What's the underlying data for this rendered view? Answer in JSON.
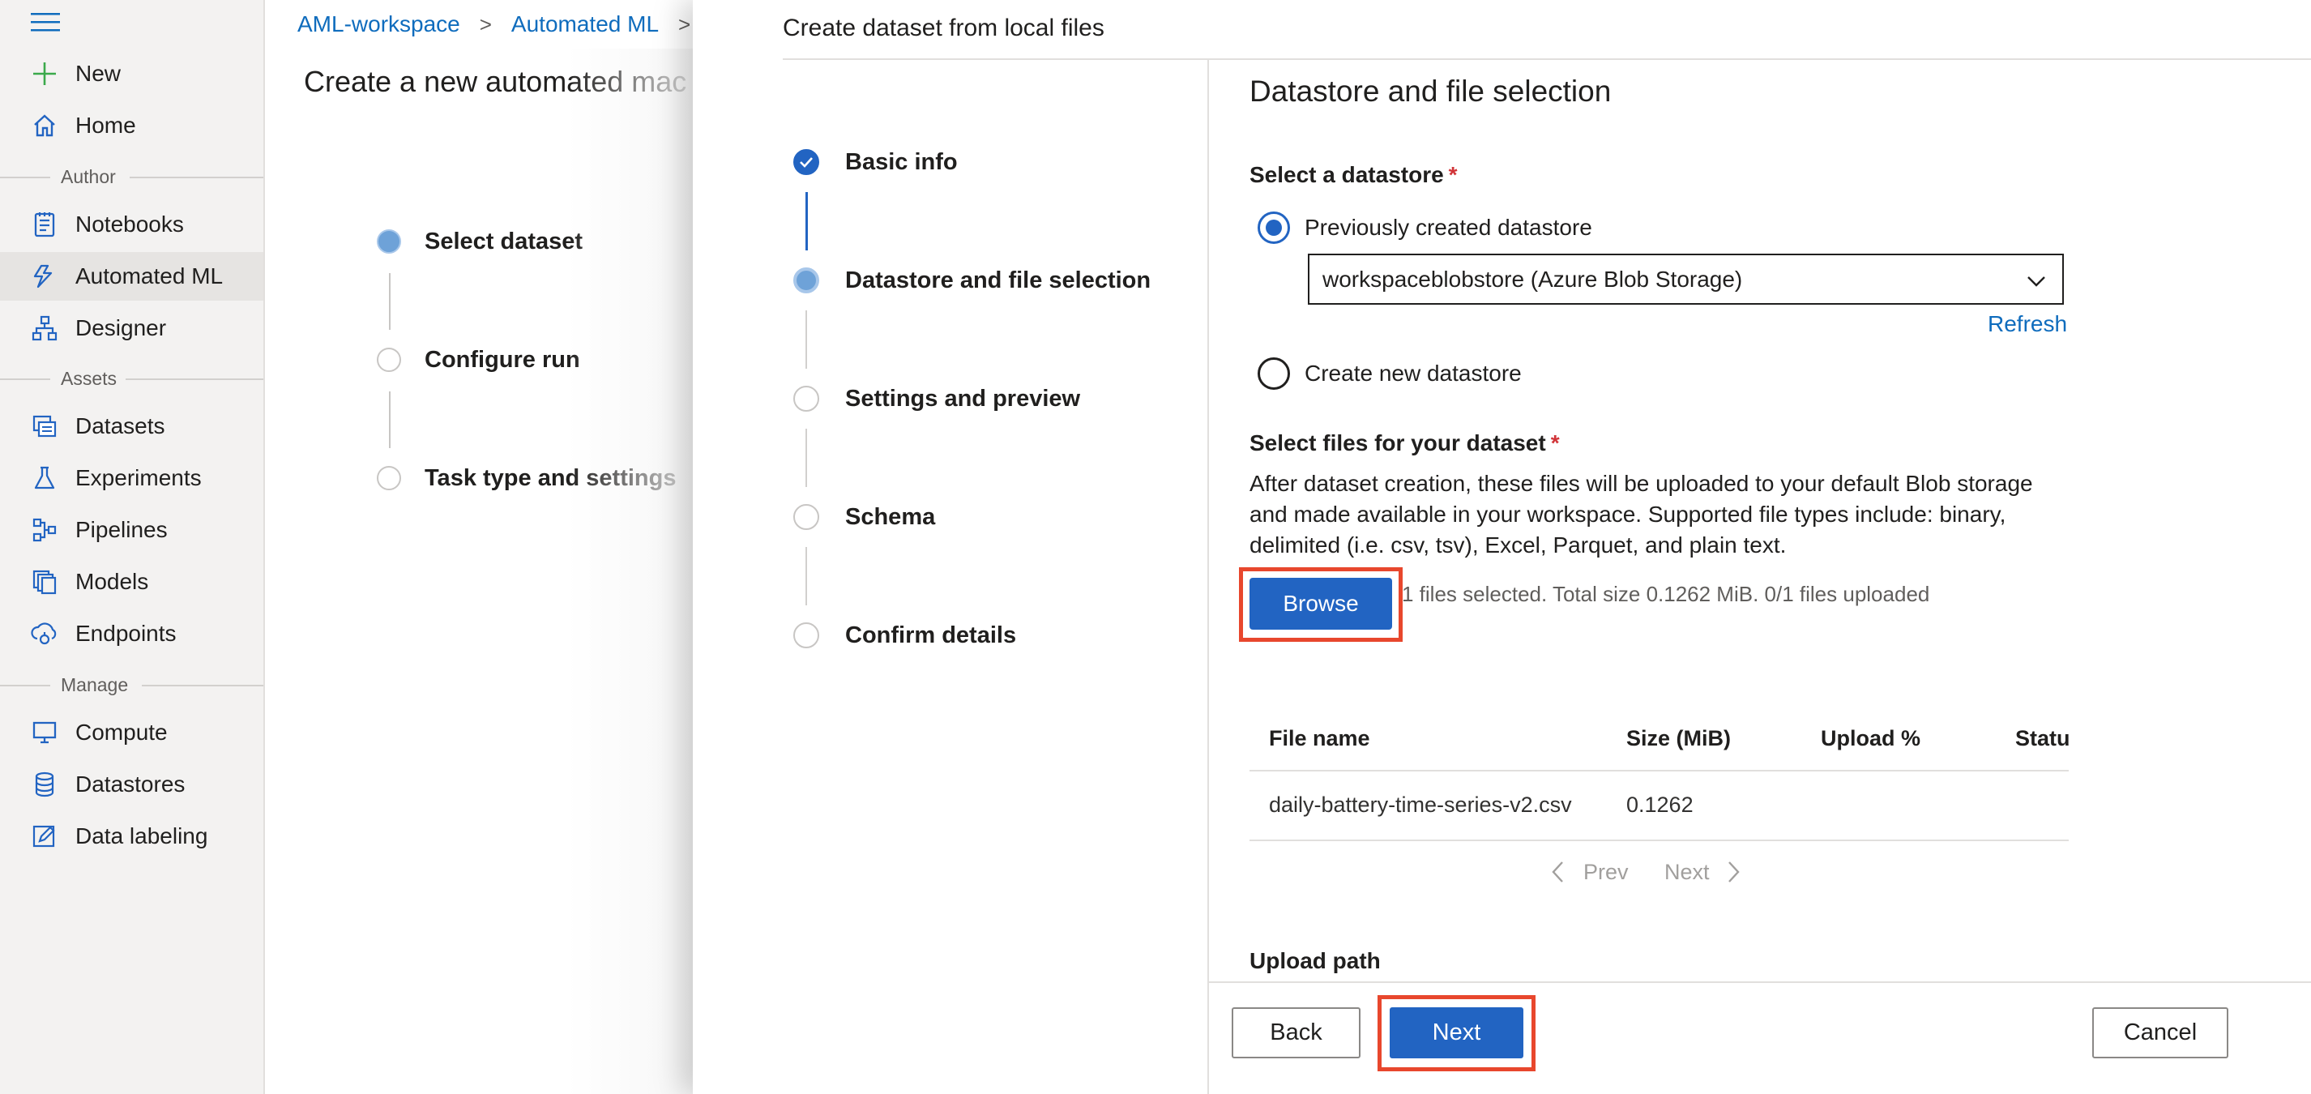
{
  "sidenav": {
    "items": [
      {
        "label": "New",
        "icon": "plus-icon"
      },
      {
        "label": "Home",
        "icon": "home-icon"
      },
      {
        "label": "Notebooks",
        "icon": "notebook-icon"
      },
      {
        "label": "Automated ML",
        "icon": "automated-ml-icon",
        "active": true
      },
      {
        "label": "Designer",
        "icon": "designer-icon"
      },
      {
        "label": "Datasets",
        "icon": "datasets-icon"
      },
      {
        "label": "Experiments",
        "icon": "flask-icon"
      },
      {
        "label": "Pipelines",
        "icon": "pipelines-icon"
      },
      {
        "label": "Models",
        "icon": "models-icon"
      },
      {
        "label": "Endpoints",
        "icon": "endpoints-icon"
      },
      {
        "label": "Compute",
        "icon": "monitor-icon"
      },
      {
        "label": "Datastores",
        "icon": "database-icon"
      },
      {
        "label": "Data labeling",
        "icon": "edit-icon"
      }
    ],
    "sections": {
      "author": "Author",
      "assets": "Assets",
      "manage": "Manage"
    }
  },
  "breadcrumb": {
    "workspace": "AML-workspace",
    "section": "Automated ML"
  },
  "background_page": {
    "title": "Create a new automated mac",
    "steps": [
      "Select dataset",
      "Configure run",
      "Task type and settings"
    ]
  },
  "panel": {
    "title": "Create dataset from local files",
    "wizard_steps": [
      "Basic info",
      "Datastore and file selection",
      "Settings and preview",
      "Schema",
      "Confirm details"
    ],
    "content_title": "Datastore and file selection",
    "select_datastore_label": "Select a datastore",
    "required_mark": "*",
    "radio_previous": "Previously created datastore",
    "datastore_value": "workspaceblobstore (Azure Blob Storage)",
    "refresh": "Refresh",
    "radio_new": "Create new datastore",
    "select_files_label": "Select files for your dataset",
    "files_description": "After dataset creation, these files will be uploaded to your default Blob storage and made available in your workspace. Supported file types include: binary, delimited (i.e. csv, tsv), Excel, Parquet, and plain text.",
    "browse": "Browse",
    "browse_status": "1 files selected. Total size 0.1262 MiB. 0/1 files uploaded",
    "table": {
      "headers": [
        "File name",
        "Size (MiB)",
        "Upload %",
        "Status"
      ],
      "rows": [
        {
          "file_name": "daily-battery-time-series-v2.csv",
          "size": "0.1262",
          "upload": "",
          "status": ""
        }
      ]
    },
    "pager": {
      "prev": "Prev",
      "next": "Next"
    },
    "upload_path": "Upload path",
    "footer": {
      "back": "Back",
      "next": "Next",
      "cancel": "Cancel"
    }
  },
  "colors": {
    "accent": "#2264c2",
    "highlight": "#e8472d",
    "link": "#0f6cbd"
  }
}
